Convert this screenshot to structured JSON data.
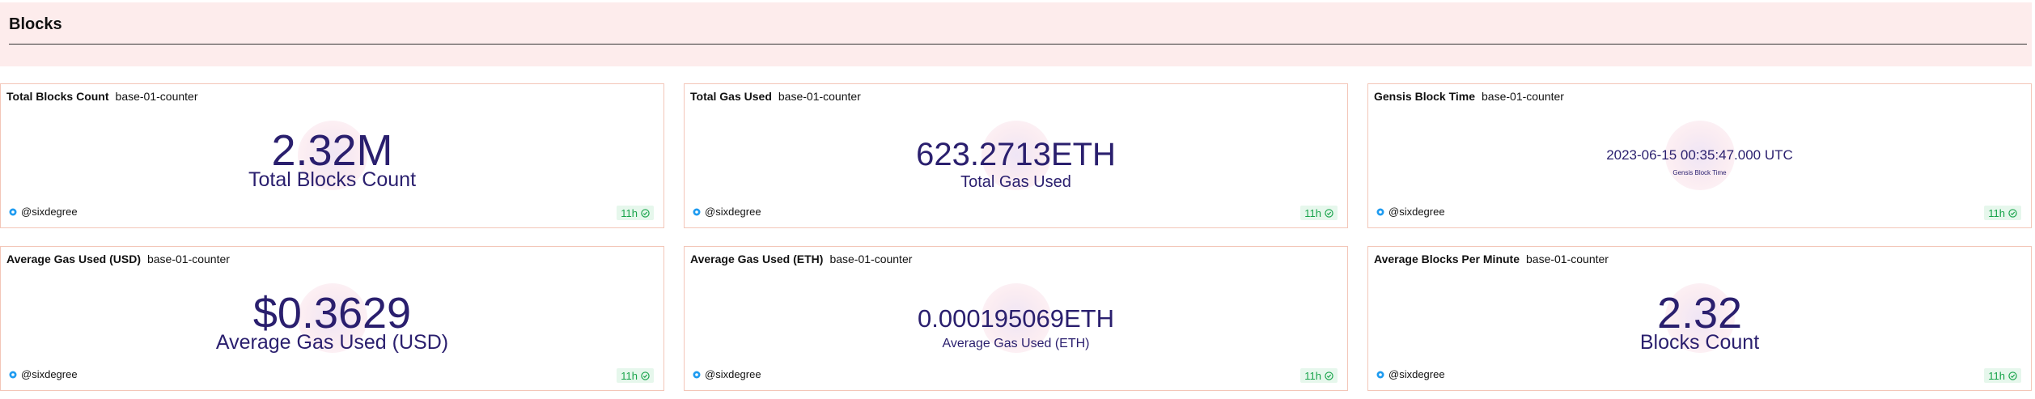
{
  "section": {
    "title": "Blocks"
  },
  "cards": [
    {
      "title": "Total Blocks Count",
      "source": "base-01-counter",
      "value": "2.32M",
      "label": "Total Blocks Count",
      "author": "@sixdegree",
      "age": "11h"
    },
    {
      "title": "Total Gas Used",
      "source": "base-01-counter",
      "value": "623.2713ETH",
      "label": "Total Gas Used",
      "author": "@sixdegree",
      "age": "11h"
    },
    {
      "title": "Gensis Block Time",
      "source": "base-01-counter",
      "value": "2023-06-15 00:35:47.000 UTC",
      "label": "Gensis Block Time",
      "author": "@sixdegree",
      "age": "11h"
    },
    {
      "title": "Average Gas Used (USD)",
      "source": "base-01-counter",
      "value": "$0.3629",
      "label": "Average Gas Used (USD)",
      "author": "@sixdegree",
      "age": "11h"
    },
    {
      "title": "Average Gas Used (ETH)",
      "source": "base-01-counter",
      "value": "0.000195069ETH",
      "label": "Average Gas Used (ETH)",
      "author": "@sixdegree",
      "age": "11h"
    },
    {
      "title": "Average Blocks Per Minute",
      "source": "base-01-counter",
      "value": "2.32",
      "label": "Blocks Count",
      "author": "@sixdegree",
      "age": "11h"
    }
  ],
  "colors": {
    "header_bg": "#fdecec",
    "card_border": "#f3c6b8",
    "metric_text": "#2a1f6e",
    "fresh_badge_bg": "#e6f7ec",
    "fresh_badge_text": "#17a34a",
    "author_icon": "#1e9bf0"
  },
  "icons": {
    "author": "sixdegree-logo-icon",
    "freshness": "check-circle-icon"
  }
}
